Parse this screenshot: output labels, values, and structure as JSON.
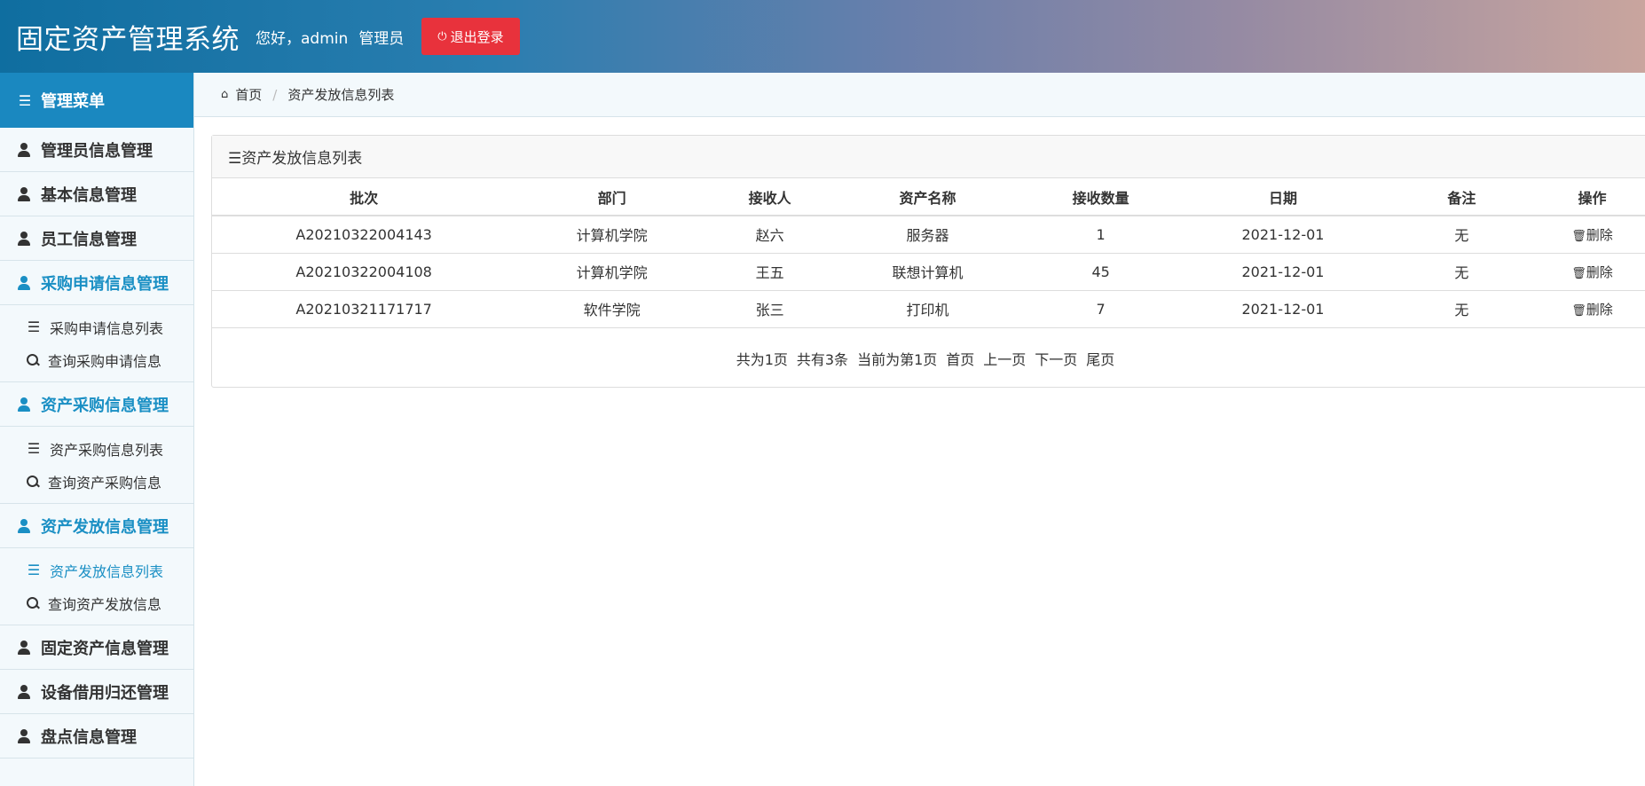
{
  "header": {
    "title": "固定资产管理系统",
    "greeting_prefix": "您好，admin",
    "role": "管理员",
    "logout_label": "退出登录"
  },
  "sidebar": {
    "heading": "管理菜单",
    "groups": [
      {
        "label": "管理员信息管理"
      },
      {
        "label": "基本信息管理"
      },
      {
        "label": "员工信息管理"
      },
      {
        "label": "采购申请信息管理",
        "items": [
          "采购申请信息列表",
          "查询采购申请信息"
        ]
      },
      {
        "label": "资产采购信息管理",
        "items": [
          "资产采购信息列表",
          "查询资产采购信息"
        ]
      },
      {
        "label": "资产发放信息管理",
        "items": [
          "资产发放信息列表",
          "查询资产发放信息"
        ]
      },
      {
        "label": "固定资产信息管理"
      },
      {
        "label": "设备借用归还管理"
      },
      {
        "label": "盘点信息管理"
      }
    ]
  },
  "breadcrumb": {
    "home": "首页",
    "current": "资产发放信息列表"
  },
  "panel": {
    "title": "☰资产发放信息列表",
    "columns": [
      "批次",
      "部门",
      "接收人",
      "资产名称",
      "接收数量",
      "日期",
      "备注",
      "操作"
    ],
    "rows": [
      {
        "batch": "A20210322004143",
        "dept": "计算机学院",
        "receiver": "赵六",
        "asset": "服务器",
        "qty": "1",
        "date": "2021-12-01",
        "note": "无",
        "action": "删除"
      },
      {
        "batch": "A20210322004108",
        "dept": "计算机学院",
        "receiver": "王五",
        "asset": "联想计算机",
        "qty": "45",
        "date": "2021-12-01",
        "note": "无",
        "action": "删除"
      },
      {
        "batch": "A20210321171717",
        "dept": "软件学院",
        "receiver": "张三",
        "asset": "打印机",
        "qty": "7",
        "date": "2021-12-01",
        "note": "无",
        "action": "删除"
      }
    ],
    "pagination": {
      "total_pages": "共为1页",
      "total_records": "共有3条",
      "current": "当前为第1页",
      "first": "首页",
      "prev": "上一页",
      "next": "下一页",
      "last": "尾页"
    }
  },
  "colors": {
    "accent": "#1a8fc4",
    "sidebar_head": "#1a88c0",
    "logout": "#e8323c"
  }
}
